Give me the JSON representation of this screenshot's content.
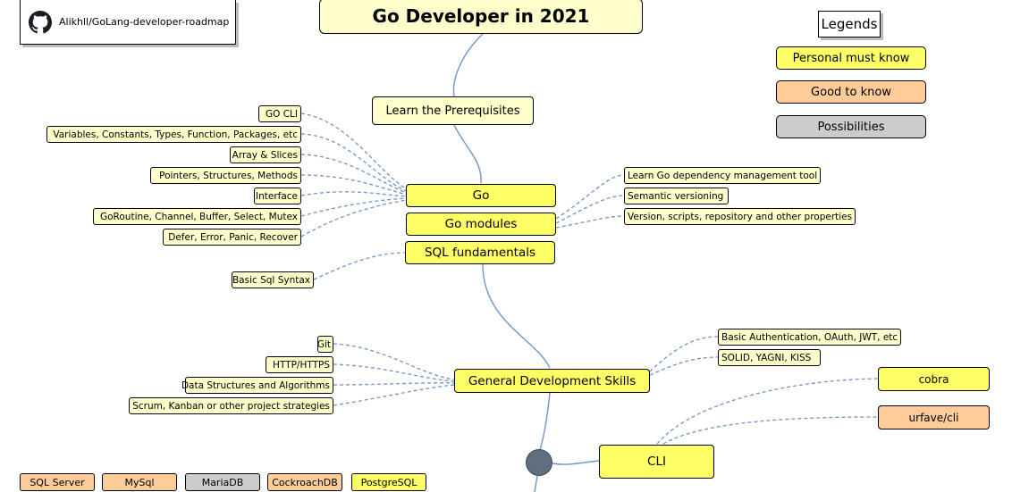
{
  "repo": {
    "icon": "github-icon",
    "label": "Alikhll/GoLang-developer-roadmap"
  },
  "title": "Go Developer in 2021",
  "legend": {
    "title": "Legends",
    "items": [
      {
        "label": "Personal must know",
        "color": "#ffff66"
      },
      {
        "label": "Good to know",
        "color": "#ffcc99"
      },
      {
        "label": "Possibilities",
        "color": "#cccccc"
      }
    ]
  },
  "nodes": {
    "prerequisites": "Learn the Prerequisites",
    "go": "Go",
    "go_modules": "Go modules",
    "sql_fundamentals": "SQL fundamentals",
    "general_skills": "General Development Skills",
    "cli": "CLI"
  },
  "go_topics": [
    "GO CLI",
    "Variables, Constants, Types, Function, Packages, etc",
    "Array & Slices",
    "Pointers, Structures, Methods",
    "Interface",
    "GoRoutine, Channel, Buffer, Select, Mutex",
    "Defer, Error, Panic, Recover"
  ],
  "module_topics": [
    "Learn Go dependency management tool",
    "Semantic versioning",
    "Version, scripts, repository and other properties"
  ],
  "sql_topics": [
    "Basic Sql Syntax"
  ],
  "general_left": [
    "Git",
    "HTTP/HTTPS",
    "Data Structures and Algorithms",
    "Scrum, Kanban or other project strategies"
  ],
  "general_right": [
    "Basic Authentication, OAuth, JWT, etc",
    "SOLID, YAGNI, KISS"
  ],
  "cli_tools": [
    {
      "label": "cobra",
      "level": "Personal must know"
    },
    {
      "label": "urfave/cli",
      "level": "Good to know"
    }
  ],
  "databases": [
    {
      "label": "SQL Server",
      "level": "Good to know"
    },
    {
      "label": "MySql",
      "level": "Good to know"
    },
    {
      "label": "MariaDB",
      "level": "Possibilities"
    },
    {
      "label": "CockroachDB",
      "level": "Good to know"
    },
    {
      "label": "PostgreSQL",
      "level": "Personal must know"
    }
  ]
}
